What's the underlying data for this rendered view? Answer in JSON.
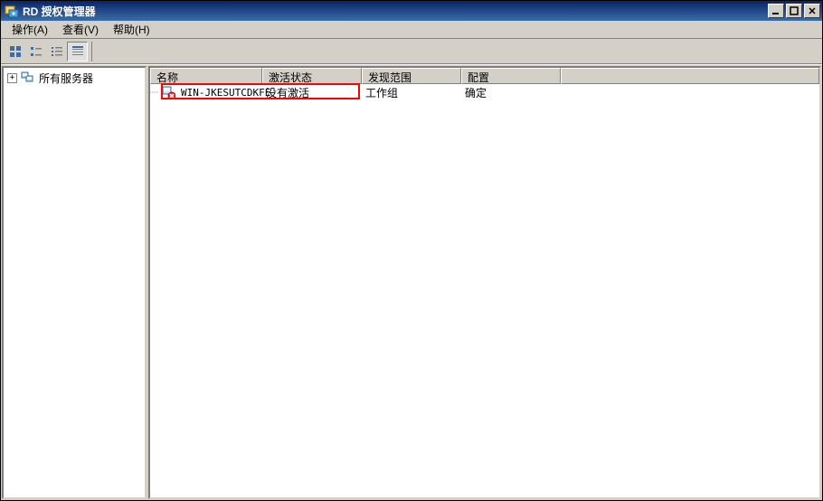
{
  "window": {
    "title": "RD 授权管理器"
  },
  "menu": {
    "action": "操作(A)",
    "view": "查看(V)",
    "help": "帮助(H)"
  },
  "tree": {
    "root": "所有服务器"
  },
  "columns": {
    "name": "名称",
    "status": "激活状态",
    "scope": "发现范围",
    "config": "配置"
  },
  "rows": [
    {
      "name": "WIN-JKESUTCDKFE",
      "status": "没有激活",
      "scope": "工作组",
      "config": "确定"
    }
  ]
}
